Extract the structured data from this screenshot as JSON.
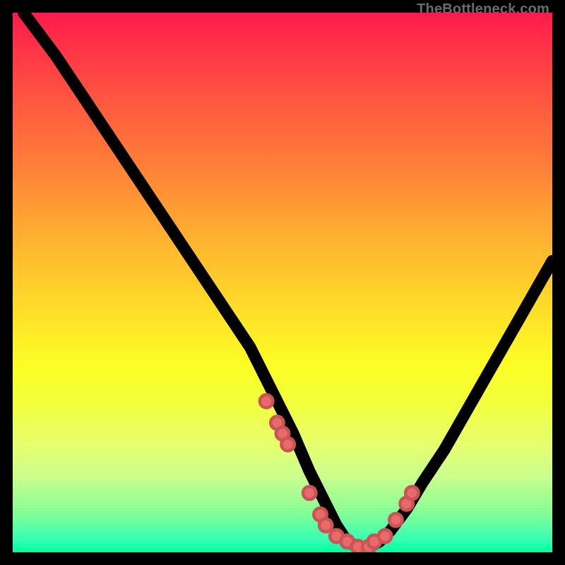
{
  "watermark": "TheBottleneck.com",
  "chart_data": {
    "type": "line",
    "title": "",
    "xlabel": "",
    "ylabel": "",
    "xlim": [
      0,
      100
    ],
    "ylim": [
      0,
      100
    ],
    "series": [
      {
        "name": "bottleneck-curve",
        "x": [
          2,
          8,
          14,
          20,
          26,
          32,
          38,
          44,
          48,
          52,
          55,
          58,
          60,
          62,
          64,
          66,
          68,
          70,
          73,
          76,
          80,
          84,
          88,
          92,
          96,
          100
        ],
        "y": [
          100,
          92,
          83,
          74,
          65,
          56,
          47,
          38,
          30,
          22,
          15,
          9,
          5,
          2,
          1,
          1,
          2,
          4,
          8,
          13,
          19,
          26,
          33,
          40,
          47,
          54
        ]
      }
    ],
    "scatter": {
      "name": "highlight-dots",
      "x": [
        47,
        49,
        50,
        51,
        55,
        57,
        58,
        60,
        62,
        64,
        66,
        67,
        69,
        71,
        73,
        74
      ],
      "y": [
        28,
        24,
        22,
        20,
        11,
        7,
        5,
        3,
        2,
        1,
        1,
        2,
        3,
        6,
        9,
        11
      ]
    },
    "background_gradient": {
      "top": "#ff1a4d",
      "mid": "#ffe128",
      "bottom": "#00ff9a"
    }
  }
}
